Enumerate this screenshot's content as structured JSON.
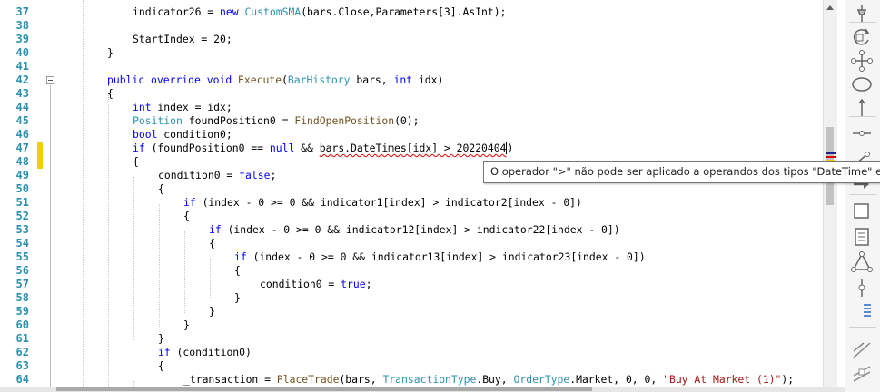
{
  "gutter": {
    "line_numbers": [
      "37",
      "38",
      "39",
      "40",
      "41",
      "42",
      "43",
      "44",
      "45",
      "46",
      "47",
      "48",
      "49",
      "50",
      "51",
      "52",
      "53",
      "54",
      "55",
      "56",
      "57",
      "58",
      "59",
      "60",
      "61",
      "62",
      "63",
      "64"
    ]
  },
  "code": {
    "l37": {
      "a": "indicator26 = ",
      "kw": "new",
      "b": " ",
      "ty": "CustomSMA",
      "c": "(bars.Close,Parameters[3].AsInt);"
    },
    "l39": "StartIndex = 20;",
    "l40": "}",
    "l42": {
      "kw1": "public",
      "kw2": "override",
      "kw3": "void",
      "fn": "Execute",
      "b": "(",
      "ty": "BarHistory",
      "c": " bars, ",
      "kw4": "int",
      "d": " idx)"
    },
    "l43": "{",
    "l44": {
      "kw": "int",
      "b": " index = idx;"
    },
    "l45": {
      "ty": "Position",
      "b": " foundPosition0 = ",
      "fn": "FindOpenPosition",
      "c": "(0);"
    },
    "l46": {
      "kw": "bool",
      "b": " condition0;"
    },
    "l47": {
      "kw": "if",
      "a": " (foundPosition0 == ",
      "kw2": "null",
      "b": " && ",
      "err": "bars.DateTimes[idx] > 20220404",
      "c": ")"
    },
    "l48": "{",
    "l49": {
      "a": "condition0 = ",
      "kw": "false",
      "b": ";"
    },
    "l50": "{",
    "l51": {
      "kw": "if",
      "b": " (index - 0 >= 0 && indicator1[index] > indicator2[index - 0])"
    },
    "l52": "{",
    "l53": {
      "kw": "if",
      "b": " (index - 0 >= 0 && indicator12[index] > indicator22[index - 0])"
    },
    "l54": "{",
    "l55": {
      "kw": "if",
      "b": " (index - 0 >= 0 && indicator13[index] > indicator23[index - 0])"
    },
    "l56": "{",
    "l57": {
      "a": "condition0 = ",
      "kw": "true",
      "b": ";"
    },
    "l58": "}",
    "l59": "}",
    "l60": "}",
    "l61": "}",
    "l62": {
      "kw": "if",
      "b": " (condition0)"
    },
    "l63": "{",
    "l64": {
      "a": "_transaction = ",
      "fn": "PlaceTrade",
      "b": "(bars, ",
      "ty1": "TransactionType",
      "c": ".Buy, ",
      "ty2": "OrderType",
      "d": ".Market, 0, 0, ",
      "st": "\"Buy At Market (1)\"",
      "e": ");"
    }
  },
  "tooltip": {
    "text": "O operador \">\" não pode ser aplicado a operandos dos tipos \"DateTime\" e \"int\""
  },
  "toolbox": {
    "icons": [
      "pin-icon",
      "rotate-icon",
      "move-icon",
      "ellipse-icon",
      "vertical-line-icon",
      "horizontal-line-icon",
      "ray-icon",
      "arrow-icon",
      "rectangle-icon",
      "text-note-icon",
      "triangle-icon",
      "fibonacci-icon",
      "stats-icon",
      "diagonal-line-icon",
      "channel-icon"
    ]
  },
  "colors": {
    "keyword": "#0000ff",
    "type": "#2b91af",
    "method": "#74531f",
    "string": "#a31515",
    "line_number": "#2b91af",
    "error_squiggle": "#e00000",
    "change_marker": "#f0d000"
  }
}
